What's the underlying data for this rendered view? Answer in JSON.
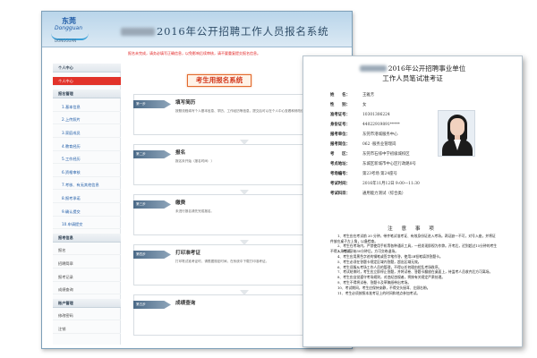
{
  "portal": {
    "logo": {
      "cn": "东莞",
      "en": "Dongguan",
      "sub": "DONGGUAN"
    },
    "title": "2016年公开招聘工作人员报名系统",
    "notice": "报名未完成，请务必填写正确信息，以免影响后续审核，请不要重复提交报名信息。",
    "sidebar": [
      {
        "label": "个人中心",
        "type": "sec"
      },
      {
        "label": "个人中心",
        "type": "active"
      },
      {
        "label": "报名管理",
        "type": "sec"
      },
      {
        "label": "1.基本信息",
        "type": "sub"
      },
      {
        "label": "2.上传照片",
        "type": "sub"
      },
      {
        "label": "3.家庭成员",
        "type": "sub"
      },
      {
        "label": "4.教育经历",
        "type": "sub"
      },
      {
        "label": "5.工作经历",
        "type": "sub"
      },
      {
        "label": "6.资格审核",
        "type": "sub"
      },
      {
        "label": "7.考核、有无其他信息",
        "type": "sub"
      },
      {
        "label": "8.报考承诺",
        "type": "sub"
      },
      {
        "label": "9.确认提交",
        "type": "sub"
      },
      {
        "label": "10.申请提交",
        "type": "sub"
      },
      {
        "label": "报考信息",
        "type": "sec"
      },
      {
        "label": "报名",
        "type": "item"
      },
      {
        "label": "招聘简章",
        "type": "item"
      },
      {
        "label": "报考记录",
        "type": "item"
      },
      {
        "label": "成绩查询",
        "type": "item"
      },
      {
        "label": "账户管理",
        "type": "sec"
      },
      {
        "label": "修改密码",
        "type": "item"
      },
      {
        "label": "注销",
        "type": "item"
      }
    ],
    "main_button": "考生用报名系统",
    "steps": [
      {
        "tag": "第一步",
        "title": "填写简历",
        "desc": "按照流程填写个人基本信息、学历、工作经历等信息，提交后可以在个人中心查看和修改信息。"
      },
      {
        "tag": "第二步",
        "title": "报名",
        "desc": "报名未开始（报名时间：）"
      },
      {
        "tag": "第三步",
        "title": "缴费",
        "desc": "未进行报名请先完成报名。"
      },
      {
        "tag": "第四步",
        "title": "打印准考证",
        "desc": "打印笔试准考证时，请根据规定时间，在系统中下载打印准考证。"
      },
      {
        "tag": "第五步",
        "title": "成绩查询",
        "desc": ""
      }
    ]
  },
  "ticket": {
    "title_line1": "2016年公开招聘事业单位",
    "title_line2": "工作人员笔试准考证",
    "fields": [
      {
        "k": "姓　　名：",
        "v": "王雅芳"
      },
      {
        "k": "性　　别：",
        "v": "女"
      },
      {
        "k": "准考证号：",
        "v": "10301306224"
      },
      {
        "k": "身份证号：",
        "v": "44022919891*****"
      },
      {
        "k": "报考单位：",
        "v": "东莞市港城服务中心"
      },
      {
        "k": "报考岗位：",
        "v": "062 ·服务业管理岗"
      },
      {
        "k": "考　　区：",
        "v": "东莞市石排中学初级城校区"
      },
      {
        "k": "考点地址：",
        "v": "东城区新城市中心区行政路8号"
      },
      {
        "k": "考场编号：",
        "v": "第23考场 第24座号"
      },
      {
        "k": "考试时间：",
        "v": "2016年11月12日 9:00—11:30"
      },
      {
        "k": "考试科目：",
        "v": "通用能力测试（综合类）"
      }
    ],
    "notes_heading": "注 意 事 项",
    "notes": [
      "1、考生应在考试前 20 分钟，带齐笔试准考证、有效身份证进入考场。两证缺一不可，对号入座，并将证件放在桌子左上角，以备检查。",
      "2、考生在考场内，严禁使用手机等各种通讯工具，一经发现即视为作弊。开考后，迟到超过15分钟的考生不得入场考试。",
      "3、考试开始30分钟后，方可交卷退场。",
      "4、考生应用黑色字迹的钢笔或签字笔作答，使用2B铅笔填涂答题卡。",
      "5、考生必须在答题卡规定区域内答题，超出区域无效。",
      "6、考生须服从考场工作人员的管理，不得以任何理由扰乱考场秩序。",
      "7、考试结束时，考生应立即停止答题，并将试卷、答题卡翻放在桌面上，待监考人员收齐后方可离场。",
      "8、考生应自觉遵守考场规则，对违纪违规者，将按有关规定严肃处理。",
      "9、考生不得将试卷、答题卡及草稿纸带出考场。",
      "10、考试期间，考生应保持安静，不得交头接耳、左顾右盼。",
      "11、考生必须按照本准考证上的时间和地点参加考试。"
    ]
  }
}
